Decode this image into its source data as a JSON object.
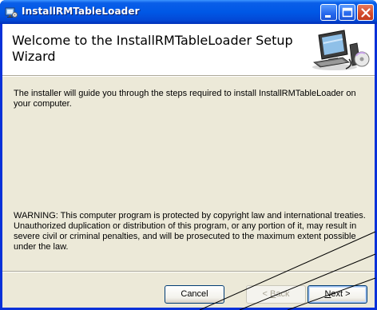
{
  "window": {
    "title": "InstallRMTableLoader",
    "icon": "installer-icon"
  },
  "title_buttons": {
    "minimize_icon": "minimize-icon",
    "maximize_icon": "maximize-icon",
    "close_icon": "close-icon"
  },
  "header": {
    "title": "Welcome to the InstallRMTableLoader Setup Wizard",
    "art_icon": "computer-setup-icon"
  },
  "body": {
    "intro": "The installer will guide you through the steps required to install InstallRMTableLoader on your computer.",
    "warning": "WARNING: This computer program is protected by copyright law and international treaties. Unauthorized duplication or distribution of this program, or any portion of it, may result in severe civil or criminal penalties, and will be prosecuted to the maximum extent possible under the law."
  },
  "buttons": {
    "cancel": "Cancel",
    "back_prefix": "< ",
    "back_key": "B",
    "back_rest": "ack",
    "next_key": "N",
    "next_rest": "ext >"
  },
  "colors": {
    "titlebar": "#0058e6",
    "window_face": "#ece9d8",
    "frame": "#0831d9"
  }
}
